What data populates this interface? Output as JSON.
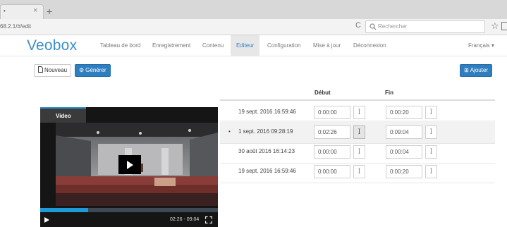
{
  "browser": {
    "tab_title": "•",
    "tab_close": "×",
    "new_tab": "+",
    "url": "68.2.1/#/edit",
    "reload_glyph": "C",
    "search_placeholder": "Rechercher",
    "star": "☆"
  },
  "nav": {
    "brand": "Veobox",
    "items": [
      {
        "label": "Tableau de bord"
      },
      {
        "label": "Enregistrement"
      },
      {
        "label": "Contenu"
      },
      {
        "label": "Editeur"
      },
      {
        "label": "Configuration"
      },
      {
        "label": "Mise à jour"
      },
      {
        "label": "Déconnexion"
      }
    ],
    "active_index": 3,
    "language": "Français ▾",
    "accent_color": "#3b8fc8"
  },
  "toolbar": {
    "new_label": "Nouveau",
    "generate_label": "Générer",
    "add_label": "Ajouter"
  },
  "table": {
    "headers": {
      "start": "Début",
      "end": "Fin"
    },
    "rows": [
      {
        "marker": "",
        "date": "19 sept. 2016 16:59:46",
        "start": "0:00:00",
        "end": "0:00:20"
      },
      {
        "marker": "•",
        "date": "1 sept. 2016 09:28:19",
        "start": "0:02:26",
        "end": "0:09:04"
      },
      {
        "marker": "",
        "date": "30 août 2016 16:14:23",
        "start": "0:00:00",
        "end": "0:00:04"
      },
      {
        "marker": "",
        "date": "19 sept. 2016 16:59:46",
        "start": "0:00:00",
        "end": "0:00:20"
      }
    ],
    "selected_row": 1,
    "cursor_glyph": "I"
  },
  "video": {
    "tab_label": "Video",
    "time": "02:26 - 09:04",
    "progress": 0.27,
    "progress_color": "#1f9ad8"
  }
}
